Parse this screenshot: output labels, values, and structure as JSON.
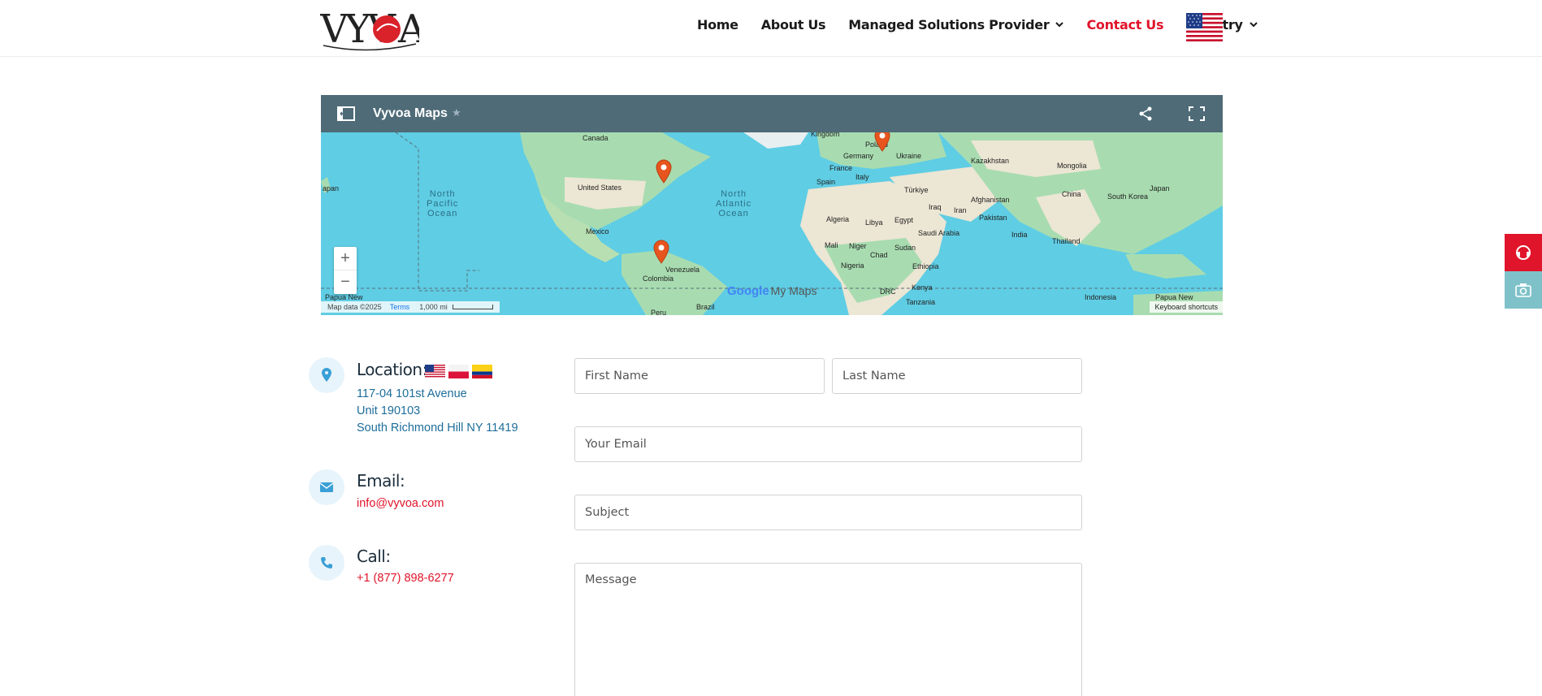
{
  "header": {
    "logo_text": "VYVOA",
    "nav": [
      {
        "label": "Home",
        "dropdown": false,
        "active": false
      },
      {
        "label": "About Us",
        "dropdown": false,
        "active": false
      },
      {
        "label": "Managed Solutions Provider",
        "dropdown": true,
        "active": false
      },
      {
        "label": "Contact Us",
        "dropdown": false,
        "active": true
      },
      {
        "label": "Country",
        "dropdown": true,
        "active": false
      }
    ],
    "country_flag_icon": "us-flag-icon"
  },
  "map": {
    "title": "Vyvoa Maps",
    "star": "★",
    "zoom_in": "+",
    "zoom_out": "−",
    "google": "Google",
    "my_maps": "My Maps",
    "map_data": "Map data ©2025",
    "terms": "Terms",
    "scale": "1,000 mi",
    "keyboard": "Keyboard shortcuts",
    "oceans": {
      "north_pacific": "North\nPacific\nOcean",
      "north_atlantic": "North\nAtlantic\nOcean"
    },
    "labels": {
      "canada": "Canada",
      "united_states": "United States",
      "mexico": "Mexico",
      "venezuela": "Venezuela",
      "colombia": "Colombia",
      "brazil": "Brazil",
      "peru": "Peru",
      "kingdom": "Kingdom",
      "germany": "Germany",
      "poland": "Poland",
      "ukraine": "Ukraine",
      "france": "France",
      "italy": "Italy",
      "spain": "Spain",
      "turkiye": "Türkiye",
      "algeria": "Algeria",
      "libya": "Libya",
      "egypt": "Egypt",
      "mali": "Mali",
      "niger": "Niger",
      "chad": "Chad",
      "sudan": "Sudan",
      "nigeria": "Nigeria",
      "ethiopia": "Ethiopia",
      "drc": "DRC",
      "kenya": "Kenya",
      "tanzania": "Tanzania",
      "saudi_arabia": "Saudi Arabia",
      "iraq": "Iraq",
      "iran": "Iran",
      "afghanistan": "Afghanistan",
      "pakistan": "Pakistan",
      "india": "India",
      "kazakhstan": "Kazakhstan",
      "mongolia": "Mongolia",
      "china": "China",
      "south_korea": "South Korea",
      "japan": "Japan",
      "japan_left": "apan",
      "thailand": "Thailand",
      "indonesia": "Indonesia",
      "papua_new_left": "Papua New",
      "papua_new_right": "Papua New"
    }
  },
  "contact": {
    "location_title": "Location:",
    "address": [
      "117-04 101st Avenue",
      "Unit 190103",
      "South Richmond Hill NY 11419"
    ],
    "email_title": "Email:",
    "email": "info@vyvoa.com",
    "call_title": "Call:",
    "phone": "+1 (877) 898-6277"
  },
  "form": {
    "first_name": "First Name",
    "last_name": "Last Name",
    "email": "Your Email",
    "subject": "Subject",
    "message": "Message"
  },
  "colors": {
    "accent_red": "#e0142a",
    "link_blue": "#1d6d9a",
    "map_bar": "#4f6b78",
    "ocean": "#5fcde4",
    "land": "#a8dcb0",
    "pin": "#e8541e"
  }
}
